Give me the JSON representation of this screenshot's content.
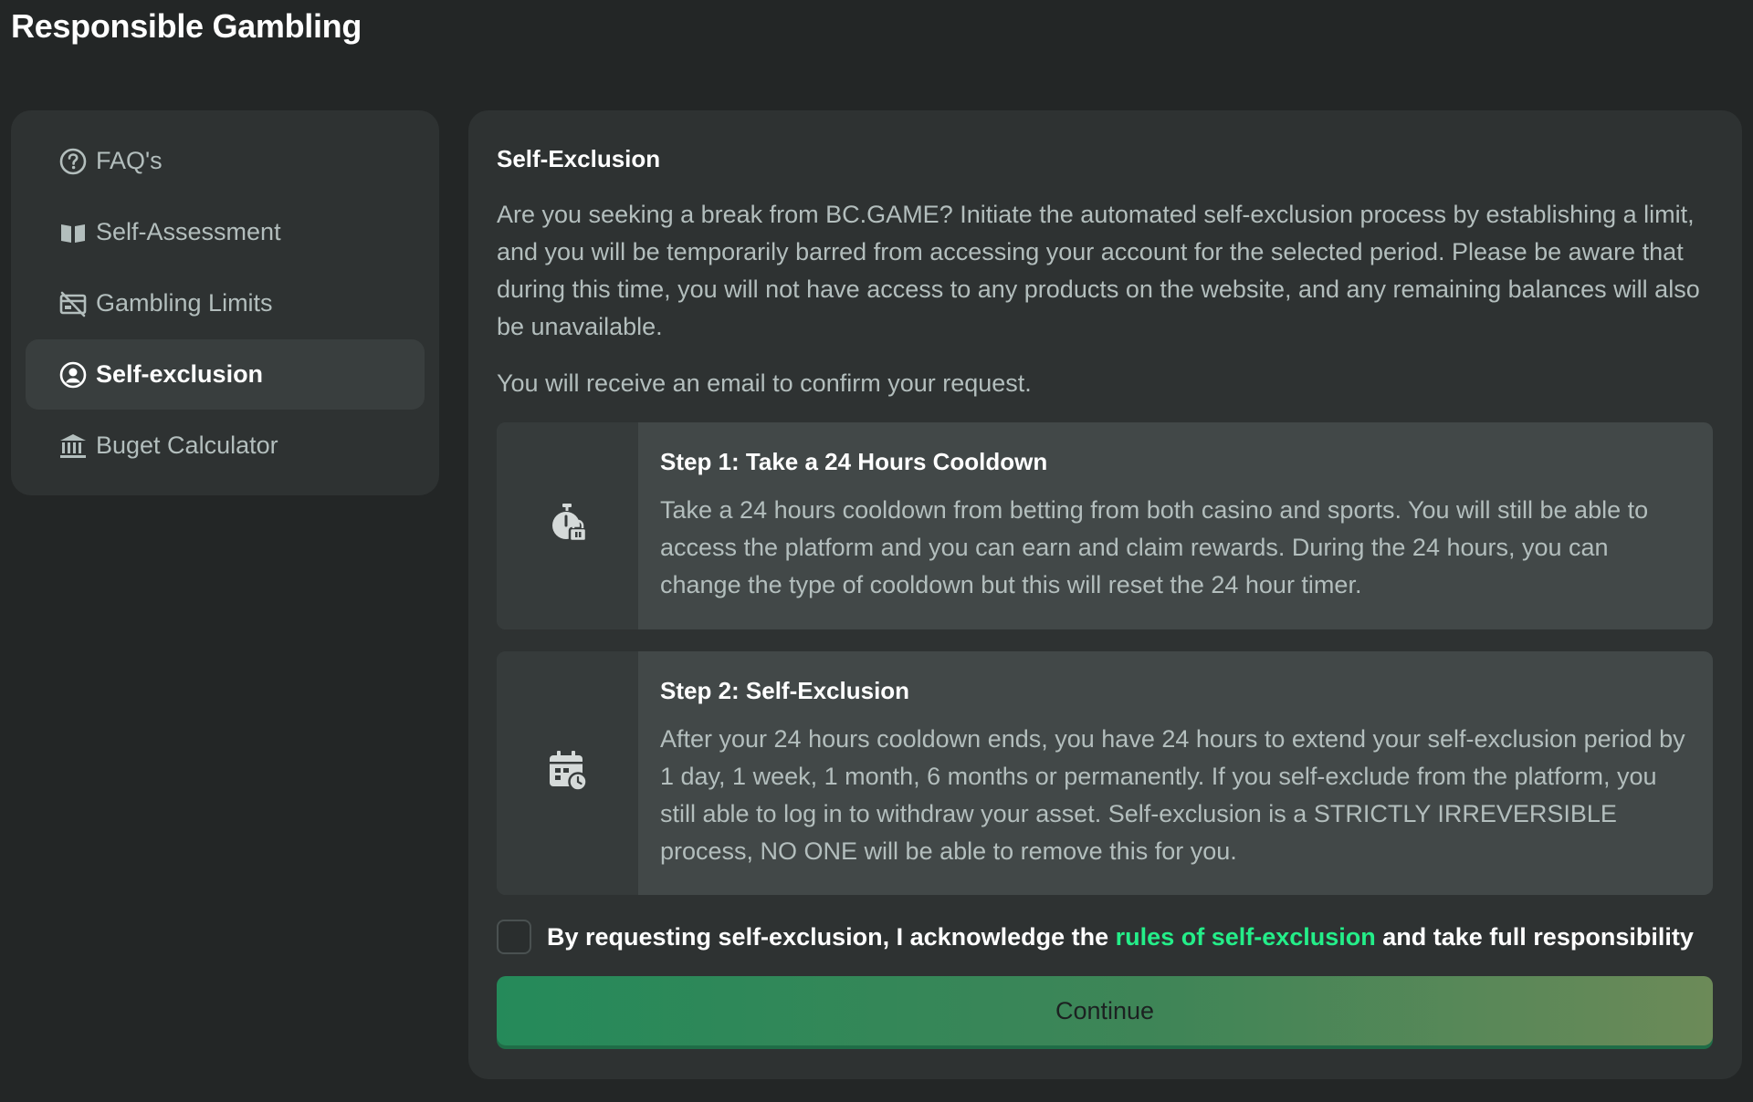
{
  "page": {
    "title": "Responsible Gambling"
  },
  "sidebar": {
    "items": [
      {
        "label": "FAQ's",
        "icon": "question-circle-icon",
        "active": false
      },
      {
        "label": "Self-Assessment",
        "icon": "book-icon",
        "active": false
      },
      {
        "label": "Gambling Limits",
        "icon": "limit-card-icon",
        "active": false
      },
      {
        "label": "Self-exclusion",
        "icon": "user-circle-icon",
        "active": true
      },
      {
        "label": "Buget Calculator",
        "icon": "bank-icon",
        "active": false
      }
    ]
  },
  "main": {
    "title": "Self-Exclusion",
    "intro": "Are you seeking a break from BC.GAME? Initiate the automated self-exclusion process by establishing a limit, and you will be temporarily barred from accessing your account for the selected period. Please be aware that during this time, you will not have access to any products on the website, and any remaining balances will also be unavailable.",
    "email_note": "You will receive an email to confirm your request.",
    "steps": [
      {
        "title": "Step 1: Take a 24 Hours Cooldown",
        "text": "Take a 24 hours cooldown from betting from both casino and sports. You will still be able to access the platform and you can earn and claim rewards. During the 24 hours, you can change the type of cooldown but this will reset the 24 hour timer.",
        "icon": "stopwatch-lock-icon"
      },
      {
        "title": "Step 2: Self-Exclusion",
        "text": "After your 24 hours cooldown ends, you have 24 hours to extend your self-exclusion period by 1 day, 1 week, 1 month, 6 months or permanently. If you self-exclude from the platform, you still able to log in to withdraw your asset. Self-exclusion is a STRICTLY IRREVERSIBLE process, NO ONE will be able to remove this for you.",
        "icon": "calendar-clock-icon"
      }
    ],
    "acknowledge": {
      "prefix": "By requesting self-exclusion, I acknowledge the ",
      "link": "rules of self-exclusion",
      "suffix": " and take full responsibility",
      "checked": false
    },
    "continue_label": "Continue"
  },
  "colors": {
    "background": "#232626",
    "panel": "#2e3232",
    "accent_green": "#24ee89",
    "text_muted": "#b3bebd"
  }
}
